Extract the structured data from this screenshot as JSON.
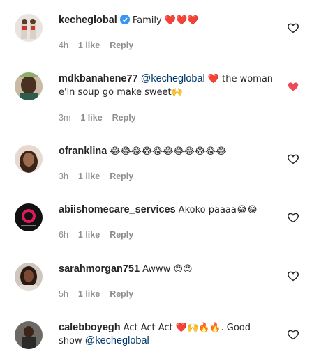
{
  "colors": {
    "link": "#00376b",
    "heart_liked": "#ed4956",
    "muted": "#8e8e8e",
    "emoji_red": "#d7263d"
  },
  "comments": [
    {
      "username": "kecheglobal",
      "verified": true,
      "text": "Family ❤️❤️❤️",
      "mention": "",
      "after": "",
      "time": "4h",
      "likes": "1 like",
      "reply": "Reply",
      "liked": false,
      "avatar": "kecheglobal-avatar"
    },
    {
      "username": "mdkbanahene77",
      "verified": false,
      "mention": "@kecheglobal",
      "text": "❤️ the woman e'in soup go make sweet🙌",
      "after": "",
      "time": "3m",
      "likes": "1 like",
      "reply": "Reply",
      "liked": true,
      "avatar": "mdkbanahene77-avatar"
    },
    {
      "username": "ofranklina",
      "verified": false,
      "text": "😂😂😂😂😂😂😂😂😂😂😂",
      "mention": "",
      "after": "",
      "time": "3h",
      "likes": "1 like",
      "reply": "Reply",
      "liked": false,
      "avatar": "ofranklina-avatar"
    },
    {
      "username": "abiishomecare_services",
      "verified": false,
      "text": "Akoko paaaa😂😂",
      "mention": "",
      "after": "",
      "time": "6h",
      "likes": "1 like",
      "reply": "Reply",
      "liked": false,
      "avatar": "abiishomecare-avatar"
    },
    {
      "username": "sarahmorgan751",
      "verified": false,
      "text": "Awww 😍😍",
      "mention": "",
      "after": "",
      "time": "5h",
      "likes": "1 like",
      "reply": "Reply",
      "liked": false,
      "avatar": "sarahmorgan751-avatar"
    },
    {
      "username": "calebboyegh",
      "verified": false,
      "text": "Act Act Act ❤️🙌🔥🔥. Good show",
      "mention": "",
      "after": "@kecheglobal",
      "time": "",
      "likes": "",
      "reply": "",
      "liked": false,
      "avatar": "calebboyegh-avatar"
    }
  ]
}
